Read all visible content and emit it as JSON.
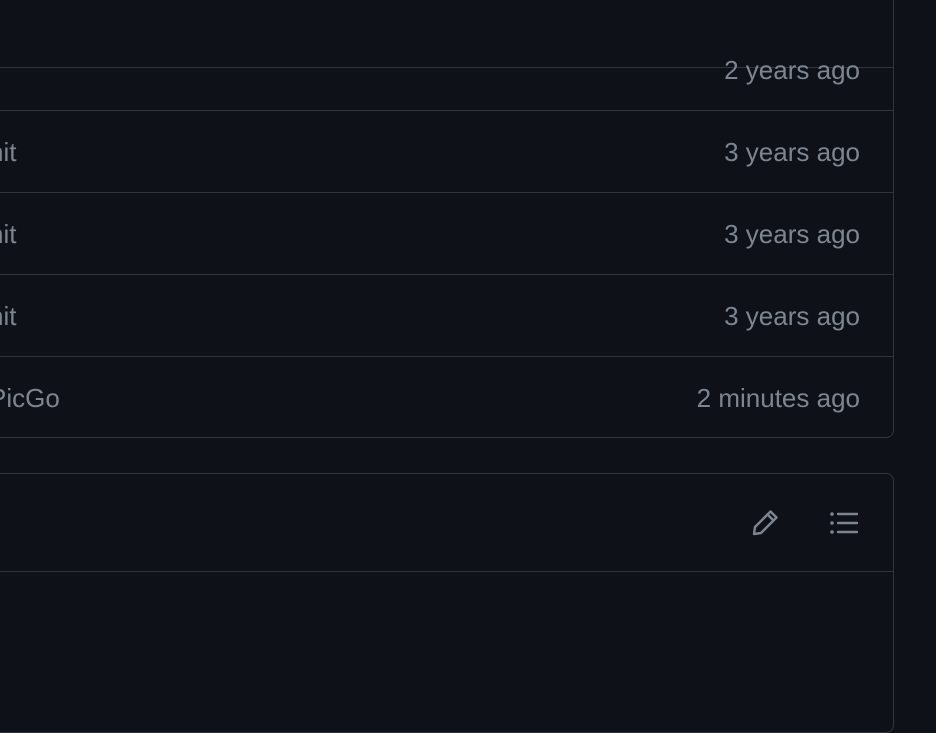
{
  "files": {
    "rows": [
      {
        "message": "",
        "time": ""
      },
      {
        "message": "",
        "time": "2 years ago"
      },
      {
        "message": "nit",
        "time": "3 years ago"
      },
      {
        "message": "nit",
        "time": "3 years ago"
      },
      {
        "message": "nit",
        "time": "3 years ago"
      },
      {
        "message": "PicGo",
        "time": "2 minutes ago"
      }
    ]
  },
  "readme": {
    "edit_icon": "pencil-icon",
    "outline_icon": "list-unordered-icon"
  },
  "colors": {
    "background": "#0e1117",
    "border": "#30363d",
    "muted_text": "#7d8590"
  }
}
